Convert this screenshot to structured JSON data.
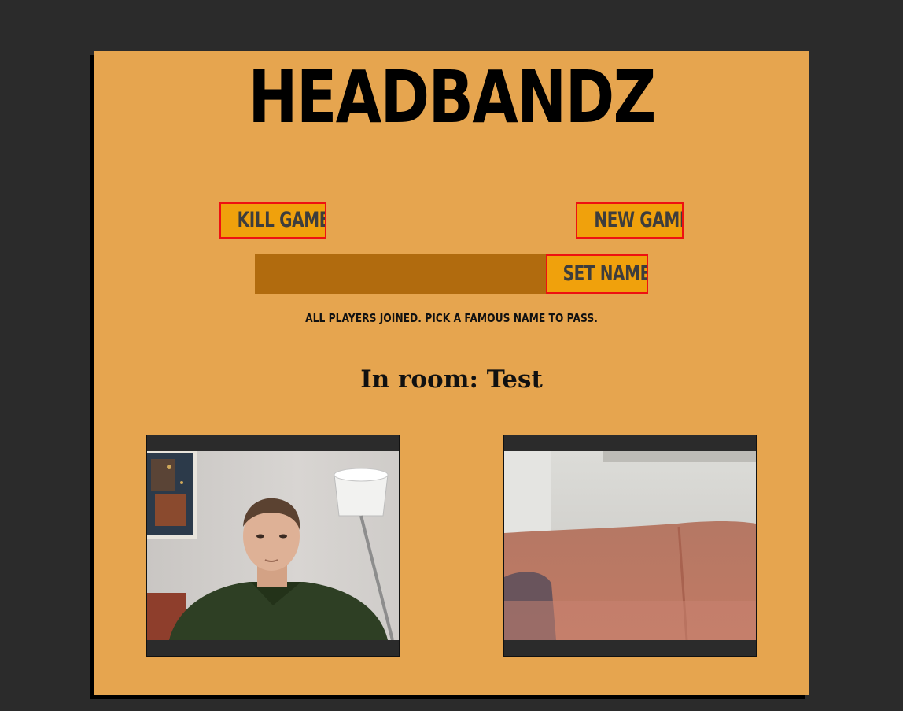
{
  "header": {
    "title": "HEADBANDZ"
  },
  "controls": {
    "kill_label": "KILL GAME",
    "new_label": "NEW GAME",
    "set_name_label": "SET NAME",
    "name_value": ""
  },
  "status_text": "All players joined. Pick a famous name to pass.",
  "room": {
    "text": "In room: Test"
  },
  "colors": {
    "page_bg": "#2b2b2b",
    "card_bg": "#e6a54f",
    "button_bg": "#f0a10c",
    "button_border": "#ee1111",
    "input_bg": "#b16b0e"
  },
  "videos": [
    {
      "name": "local-video"
    },
    {
      "name": "remote-video"
    }
  ]
}
